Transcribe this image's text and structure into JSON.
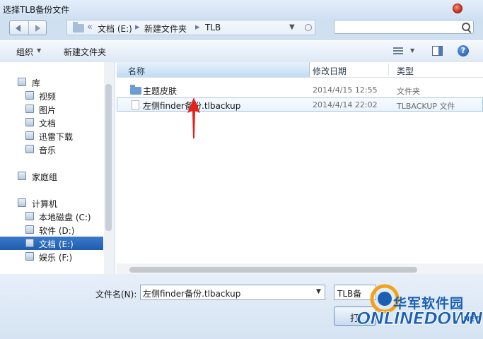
{
  "window": {
    "title": "选择TLB备份文件"
  },
  "address": {
    "overflow": "«",
    "crumbs": [
      "文档 (E:)",
      "新建文件夹",
      "TLB"
    ],
    "separator": "▸"
  },
  "toolbar": {
    "organize": "组织",
    "new_folder": "新建文件夹",
    "help": "?"
  },
  "nav": {
    "items": [
      {
        "label": "库",
        "icon": "library-icon"
      },
      {
        "label": "视频",
        "icon": "video-icon"
      },
      {
        "label": "图片",
        "icon": "picture-icon"
      },
      {
        "label": "文档",
        "icon": "document-icon"
      },
      {
        "label": "迅雷下载",
        "icon": "download-icon"
      },
      {
        "label": "音乐",
        "icon": "music-icon"
      },
      {
        "label": "家庭组",
        "icon": "homegroup-icon"
      },
      {
        "label": "计算机",
        "icon": "computer-icon"
      },
      {
        "label": "本地磁盘 (C:)",
        "icon": "drive-icon"
      },
      {
        "label": "软件 (D:)",
        "icon": "drive-icon"
      },
      {
        "label": "文档 (E:)",
        "icon": "drive-icon",
        "selected": true
      },
      {
        "label": "娱乐 (F:)",
        "icon": "drive-icon"
      }
    ]
  },
  "columns": {
    "name": "名称",
    "date": "修改日期",
    "type": "类型"
  },
  "files": [
    {
      "name": "主题皮肤",
      "date": "2014/4/15 12:55",
      "type": "文件夹",
      "icon": "folder-icon"
    },
    {
      "name": "左侧finder备份.tlbackup",
      "date": "2014/4/14 22:02",
      "type": "TLBACKUP 文件",
      "icon": "file-icon"
    }
  ],
  "footer": {
    "filename_label": "文件名(N):",
    "filename_value": "左侧finder备份.tlbackup",
    "filetype_value": "TLB备",
    "open_label": "打"
  },
  "watermark": {
    "cn": "华军软件园",
    "en": "ONLINEDOWN",
    "net": ".NET"
  },
  "colors": {
    "selection": "#1f5db0",
    "annotation_arrow": "#e8201a",
    "brand": "#1b5fb3"
  }
}
